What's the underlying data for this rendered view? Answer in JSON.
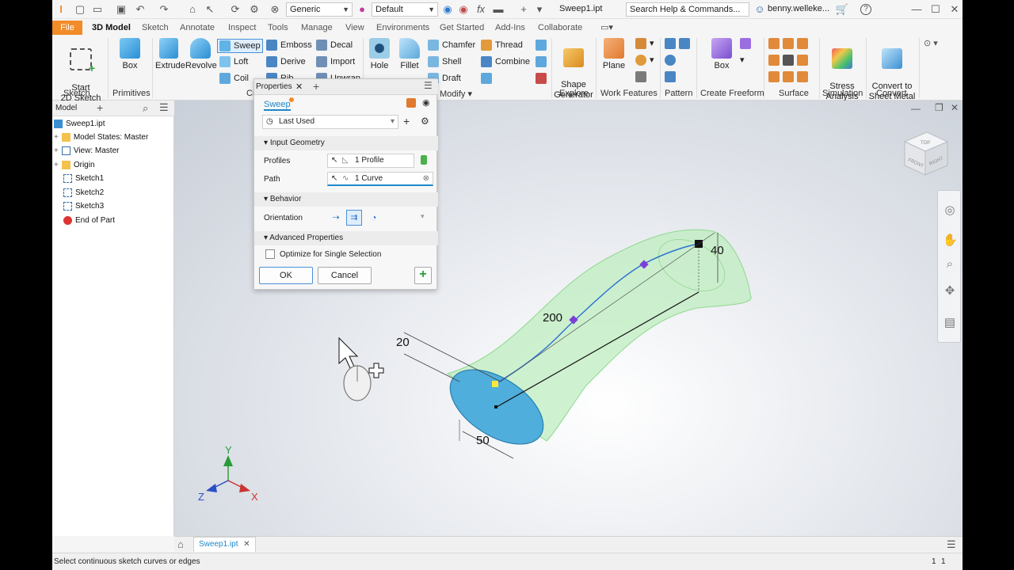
{
  "qat": {
    "material": "Generic",
    "appearance": "Default",
    "doc_title": "Sweep1.ipt",
    "search_placeholder": "Search Help & Commands...",
    "user": "benny.welleke..."
  },
  "tabs": [
    "File",
    "3D Model",
    "Sketch",
    "Annotate",
    "Inspect",
    "Tools",
    "Manage",
    "View",
    "Environments",
    "Get Started",
    "Add-Ins",
    "Collaborate"
  ],
  "ribbon": {
    "sketch": {
      "start_sketch": "Start\n2D Sketch",
      "group": "Sketch"
    },
    "primitives": {
      "box": "Box",
      "group": "Primitives"
    },
    "create": {
      "extrude": "Extrude",
      "revolve": "Revolve",
      "sweep": "Sweep",
      "loft": "Loft",
      "coil": "Coil",
      "emboss": "Emboss",
      "derive": "Derive",
      "rib": "Rib",
      "decal": "Decal",
      "import": "Import",
      "unwrap": "Unwrap",
      "group": "Cr"
    },
    "modify": {
      "hole": "Hole",
      "fillet": "Fillet",
      "chamfer": "Chamfer",
      "shell": "Shell",
      "draft": "Draft",
      "thread": "Thread",
      "combine": "Combine",
      "group": "Modify"
    },
    "explore": {
      "shape_generator": "Shape\nGenerator",
      "group": "Explore"
    },
    "work_features": {
      "plane": "Plane",
      "group": "Work Features"
    },
    "pattern": {
      "group": "Pattern"
    },
    "freeform": {
      "box": "Box",
      "group": "Create Freeform"
    },
    "surface": {
      "group": "Surface"
    },
    "simulation": {
      "stress": "Stress\nAnalysis",
      "group": "Simulation"
    },
    "convert": {
      "label": "Convert to\nSheet Metal",
      "group": "Convert"
    }
  },
  "browser": {
    "tab": "Model",
    "items": [
      {
        "label": "Sweep1.ipt",
        "icon": "part-icon"
      },
      {
        "label": "Model States: Master",
        "icon": "folder-icon"
      },
      {
        "label": "View: Master",
        "icon": "view-icon"
      },
      {
        "label": "Origin",
        "icon": "folder-icon"
      },
      {
        "label": "Sketch1",
        "icon": "sketch-icon"
      },
      {
        "label": "Sketch2",
        "icon": "sketch-icon"
      },
      {
        "label": "Sketch3",
        "icon": "sketch-icon"
      },
      {
        "label": "End of Part",
        "icon": "end-of-part-icon"
      }
    ]
  },
  "panel": {
    "tab": "Properties",
    "feature": "Sweep",
    "preset": "Last Used",
    "input_geometry": "Input Geometry",
    "profiles_label": "Profiles",
    "profiles_value": "1 Profile",
    "path_label": "Path",
    "path_value": "1 Curve",
    "behavior": "Behavior",
    "orientation": "Orientation",
    "advanced": "Advanced Properties",
    "optimize": "Optimize for Single Selection",
    "ok": "OK",
    "cancel": "Cancel"
  },
  "dimensions": {
    "d20": "20",
    "d200": "200",
    "d40": "40",
    "d50": "50"
  },
  "viewcube": {
    "top": "TOP",
    "front": "FRONT",
    "right": "RIGHT"
  },
  "axes": {
    "x": "X",
    "y": "Y",
    "z": "Z"
  },
  "doc_tab": "Sweep1.ipt",
  "status": {
    "message": "Select continuous sketch curves or edges",
    "count1": "1",
    "count2": "1"
  },
  "colors": {
    "file_tab": "#f28c28",
    "accent": "#1e88c9",
    "sweep_fill": "#bfeec0",
    "profile_fill": "#4faedb"
  }
}
